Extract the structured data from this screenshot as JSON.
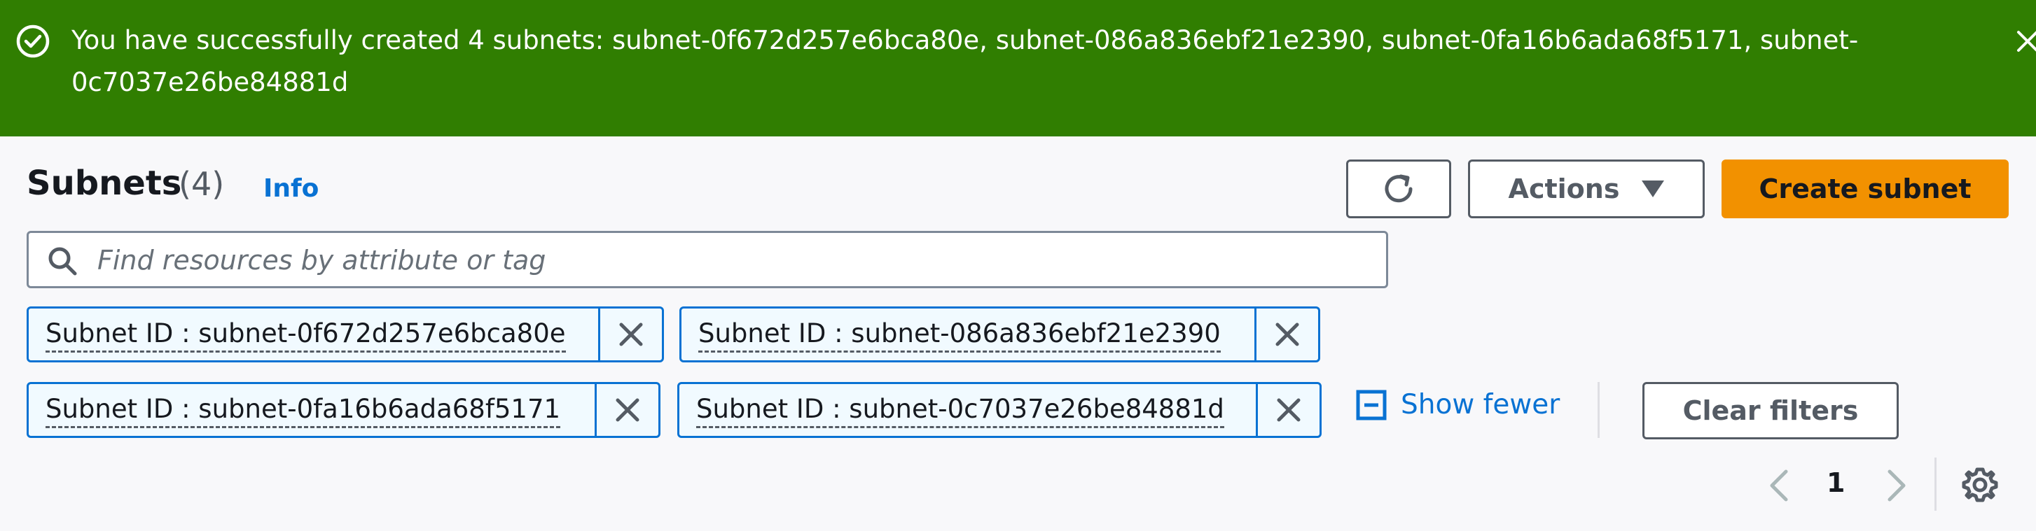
{
  "flash": {
    "message": "You have successfully created 4 subnets: subnet-0f672d257e6bca80e, subnet-086a836ebf21e2390, subnet-0fa16b6ada68f5171, subnet-0c7037e26be84881d",
    "status_color": "#307e01",
    "icon": "check-circle-icon",
    "close_icon": "close-icon"
  },
  "header": {
    "title": "Subnets",
    "count": "(4)",
    "info_label": "Info"
  },
  "toolbar": {
    "refresh_icon": "refresh-icon",
    "actions_label": "Actions",
    "create_label": "Create subnet",
    "create_color": "#f29100"
  },
  "search": {
    "placeholder": "Find resources by attribute or tag",
    "value": ""
  },
  "filters": {
    "tokens": [
      {
        "label": "Subnet ID : subnet-0f672d257e6bca80e"
      },
      {
        "label": "Subnet ID : subnet-086a836ebf21e2390"
      },
      {
        "label": "Subnet ID : subnet-0fa16b6ada68f5171"
      },
      {
        "label": "Subnet ID : subnet-0c7037e26be84881d"
      }
    ],
    "show_fewer_label": "Show fewer",
    "clear_label": "Clear filters"
  },
  "pagination": {
    "current_page": "1"
  },
  "accent_color": "#0972d3"
}
